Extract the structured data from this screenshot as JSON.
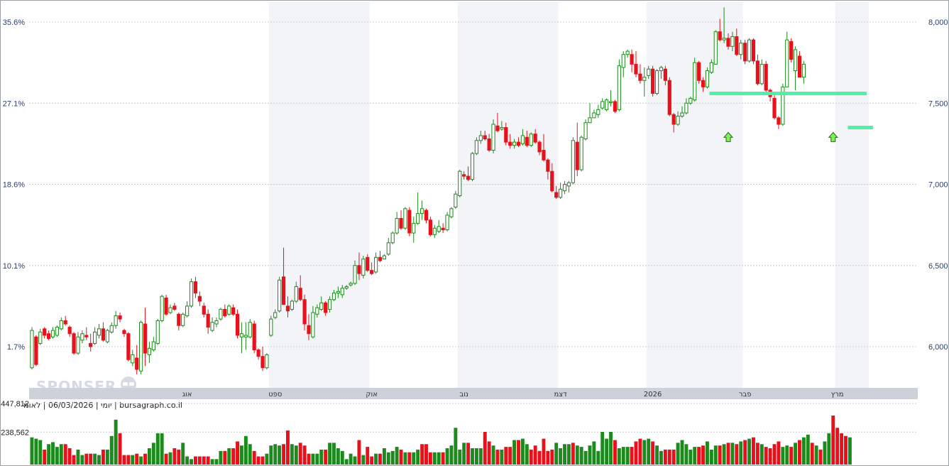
{
  "chart_data": {
    "type": "candlestick",
    "title": "",
    "info_line": "יומי | 06/03/2026 | לאומי | bursagraph.co.il",
    "watermark": "SPONSER",
    "left_axis": {
      "ticks": [
        "35.6%",
        "27.1%",
        "18.6%",
        "10.1%",
        "1.7%"
      ],
      "values": [
        35.6,
        27.1,
        18.6,
        10.1,
        1.7
      ]
    },
    "right_axis": {
      "ticks": [
        "8,000",
        "7,500",
        "7,000",
        "6,500",
        "6,000"
      ],
      "values": [
        8000,
        7500,
        7000,
        6500,
        6000
      ]
    },
    "ylim": [
      5710,
      8100
    ],
    "months": [
      "אוג",
      "ספט",
      "אוק",
      "נוב",
      "דצמ",
      "2026",
      "פבר",
      "מרץ"
    ],
    "month_index": [
      37,
      58,
      81,
      103,
      126,
      148,
      170,
      192
    ],
    "band_ranges": [
      [
        57,
        80
      ],
      [
        102,
        125
      ],
      [
        147,
        169
      ],
      [
        192,
        199
      ]
    ],
    "volume_ticks": [
      "447,812",
      "238,562"
    ],
    "volume_tick_values": [
      447812,
      238562
    ],
    "colors": {
      "up": "#1c8a1c",
      "down": "#e8111b",
      "support": "#50f0a8",
      "arrow": "#7ef05a",
      "grid": "#c9ccd2",
      "band": "#f3f4f7"
    },
    "support_lines": [
      {
        "x0": 3,
        "x1": 5,
        "price": 7560
      },
      {
        "x0": 193,
        "x1": 195,
        "price": 7350
      }
    ],
    "arrow_markers": [
      {
        "index": 166,
        "price": 7320
      },
      {
        "index": 191,
        "price": 7320
      }
    ],
    "ohlc": [
      [
        5870,
        6120,
        5860,
        6100
      ],
      [
        6060,
        6070,
        5880,
        5890
      ],
      [
        6020,
        6110,
        6010,
        6090
      ],
      [
        6110,
        6120,
        6050,
        6070
      ],
      [
        6080,
        6100,
        6040,
        6050
      ],
      [
        6060,
        6120,
        6050,
        6100
      ],
      [
        6070,
        6130,
        6060,
        6120
      ],
      [
        6110,
        6180,
        6100,
        6160
      ],
      [
        6160,
        6190,
        6130,
        6140
      ],
      [
        6120,
        6130,
        6060,
        6080
      ],
      [
        6080,
        6090,
        5950,
        5960
      ],
      [
        5960,
        6090,
        5950,
        6060
      ],
      [
        6040,
        6100,
        6020,
        6080
      ],
      [
        6070,
        6120,
        6040,
        6060
      ],
      [
        6020,
        6080,
        5970,
        6000
      ],
      [
        6020,
        6120,
        6010,
        6090
      ],
      [
        6070,
        6140,
        6050,
        6110
      ],
      [
        6110,
        6150,
        6030,
        6040
      ],
      [
        6030,
        6110,
        6020,
        6100
      ],
      [
        6090,
        6150,
        6080,
        6130
      ],
      [
        6130,
        6220,
        6110,
        6190
      ],
      [
        6190,
        6210,
        6150,
        6170
      ],
      [
        6100,
        6110,
        6060,
        6080
      ],
      [
        6080,
        6090,
        5910,
        5920
      ],
      [
        5900,
        5980,
        5880,
        5950
      ],
      [
        5930,
        6010,
        5830,
        5860
      ],
      [
        5850,
        6160,
        5830,
        6150
      ],
      [
        6140,
        6240,
        5880,
        5960
      ],
      [
        5950,
        6030,
        5900,
        5990
      ],
      [
        5980,
        6060,
        5970,
        6030
      ],
      [
        6020,
        6170,
        6010,
        6160
      ],
      [
        6160,
        6320,
        6150,
        6310
      ],
      [
        6300,
        6320,
        6190,
        6200
      ],
      [
        6210,
        6260,
        6200,
        6240
      ],
      [
        6250,
        6270,
        6220,
        6230
      ],
      [
        6200,
        6210,
        6100,
        6130
      ],
      [
        6130,
        6210,
        6120,
        6200
      ],
      [
        6190,
        6280,
        6180,
        6250
      ],
      [
        6250,
        6420,
        6240,
        6400
      ],
      [
        6400,
        6430,
        6300,
        6330
      ],
      [
        6310,
        6340,
        6250,
        6280
      ],
      [
        6250,
        6270,
        6180,
        6200
      ],
      [
        6200,
        6230,
        6080,
        6120
      ],
      [
        6100,
        6180,
        6090,
        6150
      ],
      [
        6140,
        6180,
        6120,
        6160
      ],
      [
        6170,
        6240,
        6160,
        6230
      ],
      [
        6230,
        6260,
        6180,
        6190
      ],
      [
        6200,
        6260,
        6190,
        6250
      ],
      [
        6240,
        6260,
        6190,
        6200
      ],
      [
        6200,
        6230,
        6050,
        6070
      ],
      [
        6060,
        6150,
        5960,
        6080
      ],
      [
        6060,
        6150,
        5980,
        6070
      ],
      [
        6060,
        6170,
        6050,
        6150
      ],
      [
        6140,
        6160,
        5960,
        5980
      ],
      [
        5980,
        5990,
        5920,
        5940
      ],
      [
        5940,
        6000,
        5850,
        5870
      ],
      [
        5870,
        5960,
        5860,
        5950
      ],
      [
        6070,
        6190,
        6060,
        6170
      ],
      [
        6180,
        6230,
        6170,
        6210
      ],
      [
        6220,
        6430,
        6210,
        6410
      ],
      [
        6430,
        6610,
        6260,
        6260
      ],
      [
        6250,
        6310,
        6180,
        6220
      ],
      [
        6230,
        6290,
        6220,
        6280
      ],
      [
        6280,
        6400,
        6270,
        6370
      ],
      [
        6360,
        6440,
        6280,
        6290
      ],
      [
        6290,
        6320,
        6100,
        6140
      ],
      [
        6130,
        6200,
        6040,
        6080
      ],
      [
        6060,
        6250,
        6050,
        6210
      ],
      [
        6200,
        6260,
        6180,
        6240
      ],
      [
        6230,
        6310,
        6220,
        6270
      ],
      [
        6270,
        6280,
        6190,
        6210
      ],
      [
        6230,
        6310,
        6210,
        6290
      ],
      [
        6290,
        6350,
        6280,
        6330
      ],
      [
        6330,
        6370,
        6300,
        6340
      ],
      [
        6320,
        6380,
        6300,
        6360
      ],
      [
        6360,
        6380,
        6350,
        6370
      ],
      [
        6380,
        6400,
        6370,
        6390
      ],
      [
        6390,
        6530,
        6380,
        6500
      ],
      [
        6500,
        6580,
        6410,
        6450
      ],
      [
        6440,
        6560,
        6420,
        6540
      ],
      [
        6550,
        6570,
        6460,
        6470
      ],
      [
        6470,
        6520,
        6440,
        6450
      ],
      [
        6460,
        6580,
        6450,
        6550
      ],
      [
        6550,
        6590,
        6520,
        6530
      ],
      [
        6540,
        6570,
        6540,
        6560
      ],
      [
        6570,
        6670,
        6560,
        6640
      ],
      [
        6640,
        6710,
        6630,
        6700
      ],
      [
        6700,
        6830,
        6690,
        6790
      ],
      [
        6790,
        6840,
        6720,
        6730
      ],
      [
        6730,
        6860,
        6720,
        6850
      ],
      [
        6840,
        6860,
        6680,
        6700
      ],
      [
        6700,
        6800,
        6640,
        6760
      ],
      [
        6760,
        6950,
        6750,
        6820
      ],
      [
        6820,
        6900,
        6780,
        6850
      ],
      [
        6840,
        6850,
        6760,
        6780
      ],
      [
        6780,
        6800,
        6680,
        6690
      ],
      [
        6690,
        6750,
        6670,
        6730
      ],
      [
        6710,
        6780,
        6700,
        6740
      ],
      [
        6730,
        6760,
        6700,
        6720
      ],
      [
        6720,
        6830,
        6710,
        6810
      ],
      [
        6800,
        6860,
        6790,
        6850
      ],
      [
        6860,
        6960,
        6850,
        6940
      ],
      [
        6930,
        7090,
        6920,
        7080
      ],
      [
        7060,
        7080,
        7030,
        7050
      ],
      [
        7050,
        7110,
        7020,
        7030
      ],
      [
        7030,
        7200,
        7020,
        7190
      ],
      [
        7190,
        7290,
        7180,
        7270
      ],
      [
        7270,
        7330,
        7250,
        7300
      ],
      [
        7300,
        7330,
        7270,
        7280
      ],
      [
        7280,
        7310,
        7200,
        7210
      ],
      [
        7210,
        7400,
        7190,
        7370
      ],
      [
        7360,
        7440,
        7320,
        7330
      ],
      [
        7340,
        7390,
        7330,
        7350
      ],
      [
        7350,
        7380,
        7240,
        7260
      ],
      [
        7260,
        7310,
        7220,
        7240
      ],
      [
        7240,
        7280,
        7220,
        7260
      ],
      [
        7260,
        7290,
        7230,
        7240
      ],
      [
        7250,
        7340,
        7240,
        7300
      ],
      [
        7290,
        7330,
        7230,
        7240
      ],
      [
        7240,
        7320,
        7230,
        7310
      ],
      [
        7310,
        7340,
        7250,
        7260
      ],
      [
        7260,
        7270,
        7180,
        7200
      ],
      [
        7210,
        7310,
        7140,
        7150
      ],
      [
        7150,
        7160,
        7030,
        7080
      ],
      [
        7080,
        7130,
        6950,
        6960
      ],
      [
        6950,
        6990,
        6910,
        6920
      ],
      [
        6920,
        7010,
        6910,
        6970
      ],
      [
        6960,
        7020,
        6940,
        7000
      ],
      [
        6990,
        7020,
        6950,
        7010
      ],
      [
        7010,
        7290,
        7000,
        7270
      ],
      [
        7260,
        7380,
        7050,
        7090
      ],
      [
        7090,
        7300,
        7080,
        7290
      ],
      [
        7280,
        7400,
        7270,
        7380
      ],
      [
        7380,
        7500,
        7380,
        7410
      ],
      [
        7410,
        7460,
        7410,
        7440
      ],
      [
        7430,
        7490,
        7410,
        7460
      ],
      [
        7470,
        7530,
        7460,
        7510
      ],
      [
        7460,
        7530,
        7450,
        7520
      ],
      [
        7510,
        7580,
        7480,
        7510
      ],
      [
        7510,
        7520,
        7440,
        7450
      ],
      [
        7460,
        7770,
        7450,
        7730
      ],
      [
        7720,
        7820,
        7660,
        7800
      ],
      [
        7800,
        7830,
        7780,
        7820
      ],
      [
        7800,
        7830,
        7690,
        7740
      ],
      [
        7740,
        7820,
        7660,
        7680
      ],
      [
        7680,
        7740,
        7620,
        7640
      ],
      [
        7640,
        7720,
        7540,
        7660
      ],
      [
        7670,
        7730,
        7650,
        7710
      ],
      [
        7710,
        7730,
        7540,
        7560
      ],
      [
        7560,
        7710,
        7550,
        7700
      ],
      [
        7700,
        7730,
        7650,
        7720
      ],
      [
        7710,
        7730,
        7610,
        7640
      ],
      [
        7640,
        7660,
        7420,
        7430
      ],
      [
        7430,
        7440,
        7320,
        7370
      ],
      [
        7370,
        7450,
        7360,
        7420
      ],
      [
        7420,
        7480,
        7410,
        7440
      ],
      [
        7440,
        7530,
        7430,
        7500
      ],
      [
        7500,
        7540,
        7490,
        7530
      ],
      [
        7520,
        7780,
        7510,
        7750
      ],
      [
        7750,
        7760,
        7620,
        7640
      ],
      [
        7640,
        7660,
        7570,
        7600
      ],
      [
        7600,
        7720,
        7590,
        7700
      ],
      [
        7690,
        7770,
        7680,
        7750
      ],
      [
        7740,
        7950,
        7740,
        7940
      ],
      [
        7940,
        8020,
        7880,
        7890
      ],
      [
        7890,
        8090,
        7870,
        7900
      ],
      [
        7900,
        7930,
        7830,
        7850
      ],
      [
        7850,
        7940,
        7820,
        7910
      ],
      [
        7910,
        7960,
        7790,
        7800
      ],
      [
        7800,
        7890,
        7770,
        7870
      ],
      [
        7870,
        7890,
        7740,
        7760
      ],
      [
        7760,
        7900,
        7750,
        7890
      ],
      [
        7890,
        7900,
        7740,
        7760
      ],
      [
        7760,
        7800,
        7610,
        7620
      ],
      [
        7620,
        7770,
        7610,
        7740
      ],
      [
        7740,
        7760,
        7560,
        7580
      ],
      [
        7580,
        7590,
        7510,
        7540
      ],
      [
        7530,
        7560,
        7400,
        7410
      ],
      [
        7410,
        7420,
        7340,
        7370
      ],
      [
        7370,
        7620,
        7360,
        7600
      ],
      [
        7600,
        7940,
        7600,
        7890
      ],
      [
        7880,
        7900,
        7750,
        7770
      ],
      [
        7700,
        7850,
        7580,
        7830
      ],
      [
        7790,
        7820,
        7660,
        7660
      ],
      [
        7660,
        7760,
        7620,
        7740
      ]
    ],
    "volume": [
      200000,
      190000,
      180000,
      110000,
      150000,
      165000,
      130000,
      150000,
      150000,
      120000,
      70000,
      110000,
      70000,
      80000,
      80000,
      80000,
      70000,
      110000,
      110000,
      210000,
      330000,
      230000,
      70000,
      70000,
      70000,
      80000,
      60000,
      80000,
      120000,
      160000,
      230000,
      230000,
      80000,
      90000,
      120000,
      110000,
      160000,
      60000,
      40000,
      60000,
      60000,
      60000,
      60000,
      40000,
      40000,
      100000,
      100000,
      120000,
      120000,
      170000,
      140000,
      210000,
      150000,
      100000,
      60000,
      60000,
      80000,
      140000,
      150000,
      140000,
      150000,
      250000,
      150000,
      140000,
      160000,
      140000,
      80000,
      80000,
      80000,
      110000,
      110000,
      160000,
      160000,
      120000,
      100000,
      40000,
      80000,
      60000,
      180000,
      70000,
      130000,
      60000,
      80000,
      80000,
      120000,
      90000,
      100000,
      130000,
      110000,
      90000,
      90000,
      90000,
      110000,
      150000,
      150000,
      90000,
      90000,
      90000,
      90000,
      120000,
      140000,
      270000,
      110000,
      160000,
      160000,
      120000,
      120000,
      120000,
      240000,
      170000,
      140000,
      110000,
      110000,
      130000,
      130000,
      180000,
      180000,
      190000,
      150000,
      110000,
      140000,
      100000,
      190000,
      100000,
      110000,
      160000,
      120000,
      150000,
      150000,
      160000,
      140000,
      130000,
      100000,
      140000,
      170000,
      100000,
      240000,
      190000,
      240000,
      180000,
      120000,
      130000,
      130000,
      130000,
      170000,
      190000,
      180000,
      190000,
      170000,
      140000,
      100000,
      110000,
      110000,
      110000,
      160000,
      180000,
      150000,
      110000,
      130000,
      130000,
      140000,
      170000,
      110000,
      140000,
      140000,
      150000,
      160000,
      160000,
      150000,
      170000,
      180000,
      190000,
      200000,
      160000,
      150000,
      130000,
      120000,
      150000,
      170000,
      130000,
      140000,
      130000,
      160000,
      180000,
      200000,
      220000,
      160000,
      140000,
      110000,
      170000,
      230000,
      360000,
      270000,
      230000,
      210000,
      200000
    ],
    "volume_up": [
      1,
      1,
      1,
      0,
      1,
      1,
      1,
      1,
      0,
      0,
      0,
      1,
      1,
      0,
      0,
      1,
      1,
      0,
      1,
      1,
      1,
      0,
      0,
      0,
      1,
      0,
      1,
      0,
      1,
      1,
      1,
      1,
      0,
      1,
      0,
      0,
      1,
      1,
      1,
      0,
      0,
      0,
      0,
      1,
      1,
      1,
      0,
      1,
      0,
      0,
      1,
      1,
      1,
      0,
      0,
      0,
      1,
      1,
      1,
      1,
      0,
      0,
      1,
      1,
      0,
      0,
      0,
      1,
      1,
      1,
      0,
      1,
      1,
      1,
      1,
      1,
      1,
      1,
      0,
      1,
      0,
      0,
      1,
      0,
      1,
      1,
      1,
      1,
      0,
      1,
      0,
      1,
      1,
      0,
      0,
      0,
      1,
      1,
      0,
      1,
      1,
      1,
      1,
      1,
      0,
      1,
      1,
      1,
      0,
      0,
      1,
      0,
      1,
      0,
      0,
      1,
      0,
      1,
      1,
      0,
      0,
      0,
      0,
      0,
      0,
      1,
      1,
      1,
      1,
      0,
      1,
      1,
      1,
      1,
      1,
      1,
      1,
      1,
      1,
      0,
      1,
      1,
      1,
      0,
      0,
      0,
      1,
      1,
      0,
      1,
      1,
      0,
      0,
      0,
      1,
      1,
      1,
      1,
      1,
      0,
      0,
      1,
      1,
      1,
      0,
      1,
      0,
      1,
      0,
      1,
      0,
      1,
      0,
      0,
      1,
      0,
      0,
      0,
      0,
      1,
      1,
      0,
      1,
      0,
      1,
      1,
      0,
      1,
      0,
      1,
      1,
      0,
      0,
      0,
      0,
      1
    ]
  }
}
